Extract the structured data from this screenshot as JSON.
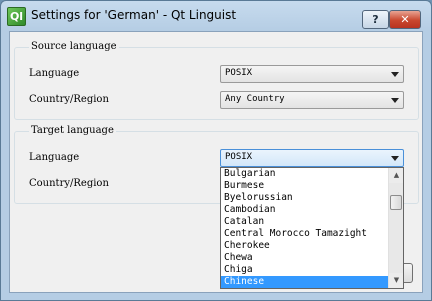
{
  "window": {
    "title": "Settings for 'German' - Qt Linguist",
    "app_icon": "Ql",
    "help_label": "?",
    "close_label": "✕"
  },
  "source": {
    "title": "Source language",
    "language_label": "Language",
    "language_value": "POSIX",
    "country_label": "Country/Region",
    "country_value": "Any Country"
  },
  "target": {
    "title": "Target language",
    "language_label": "Language",
    "language_value": "POSIX",
    "country_label": "Country/Region"
  },
  "dropdown": {
    "items": [
      "Bulgarian",
      "Burmese",
      "Byelorussian",
      "Cambodian",
      "Catalan",
      "Central Morocco Tamazight",
      "Cherokee",
      "Chewa",
      "Chiga",
      "Chinese"
    ],
    "selected": "Chinese",
    "scroll_up": "▲",
    "scroll_down": "▼"
  },
  "colors": {
    "selection": "#3399ff",
    "close_button": "#c9472e"
  }
}
